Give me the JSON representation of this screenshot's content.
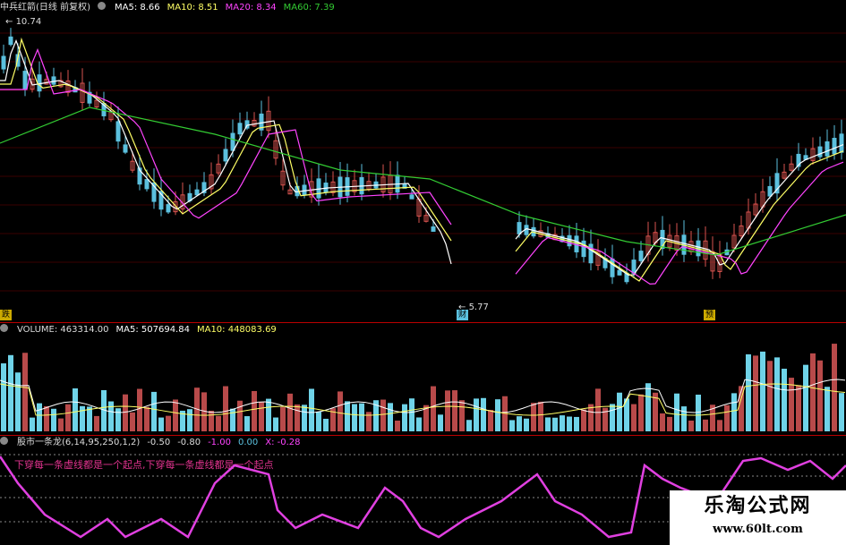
{
  "price_panel": {
    "title": "中兵红箭(日线 前复权)",
    "ma5": "MA5: 8.66",
    "ma10": "MA10: 8.51",
    "ma20": "MA20: 8.34",
    "ma60": "MA60: 7.39",
    "high_label": "10.74",
    "low_label": "5.77",
    "tag_left": "跌",
    "tag_mid": "财",
    "tag_right": "预",
    "colors": {
      "ma5": "#ffffff",
      "ma10": "#ffff66",
      "ma20": "#ff44ff",
      "ma60": "#33cc33",
      "up": "#d9534f",
      "down": "#5bc0de"
    }
  },
  "volume_panel": {
    "volume": "VOLUME: 463314.00",
    "ma5": "MA5: 507694.84",
    "ma10": "MA10: 448083.69"
  },
  "indicator_panel": {
    "title": "股市一条龙(6,14,95,250,1,2)",
    "v1": "-0.50",
    "v2": "-0.80",
    "v3": "-1.00",
    "v4": "0.00",
    "x": "X: -0.28",
    "note": "下穿每一条虚线都是一个起点,下穿每一条虚线都是一个起点"
  },
  "watermark": {
    "cn": "乐淘公式网",
    "en": "www.60lt.com"
  }
}
